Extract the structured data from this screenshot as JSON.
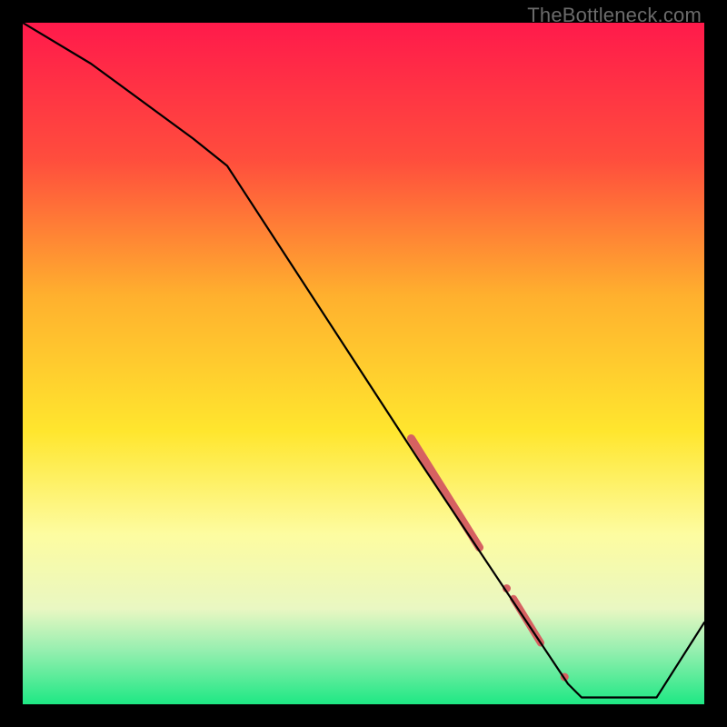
{
  "watermark": "TheBottleneck.com",
  "chart_data": {
    "type": "line",
    "title": "",
    "xlabel": "",
    "ylabel": "",
    "xlim": [
      0,
      100
    ],
    "ylim": [
      0,
      100
    ],
    "gradient_stops": [
      {
        "offset": 0,
        "color": "#ff1a4b"
      },
      {
        "offset": 20,
        "color": "#ff4d3d"
      },
      {
        "offset": 40,
        "color": "#ffb02e"
      },
      {
        "offset": 60,
        "color": "#ffe62e"
      },
      {
        "offset": 75,
        "color": "#fdfca0"
      },
      {
        "offset": 86,
        "color": "#e9f7c2"
      },
      {
        "offset": 92,
        "color": "#97efb0"
      },
      {
        "offset": 100,
        "color": "#1ee884"
      }
    ],
    "series": [
      {
        "name": "curve",
        "x": [
          0,
          10,
          25,
          30,
          58,
          80,
          82,
          93,
          100
        ],
        "y": [
          100,
          94,
          83,
          79,
          36,
          3,
          1,
          1,
          12
        ]
      }
    ],
    "markers": [
      {
        "kind": "line",
        "x1": 57,
        "y1": 39,
        "x2": 67,
        "y2": 23,
        "color": "#d66161",
        "width": 9
      },
      {
        "kind": "point",
        "x": 71,
        "y": 17,
        "r": 4.5,
        "color": "#d66161"
      },
      {
        "kind": "line",
        "x1": 72,
        "y1": 15.5,
        "x2": 76,
        "y2": 9,
        "color": "#d66161",
        "width": 8
      },
      {
        "kind": "point",
        "x": 79.5,
        "y": 4,
        "r": 4.5,
        "color": "#d66161"
      }
    ]
  }
}
